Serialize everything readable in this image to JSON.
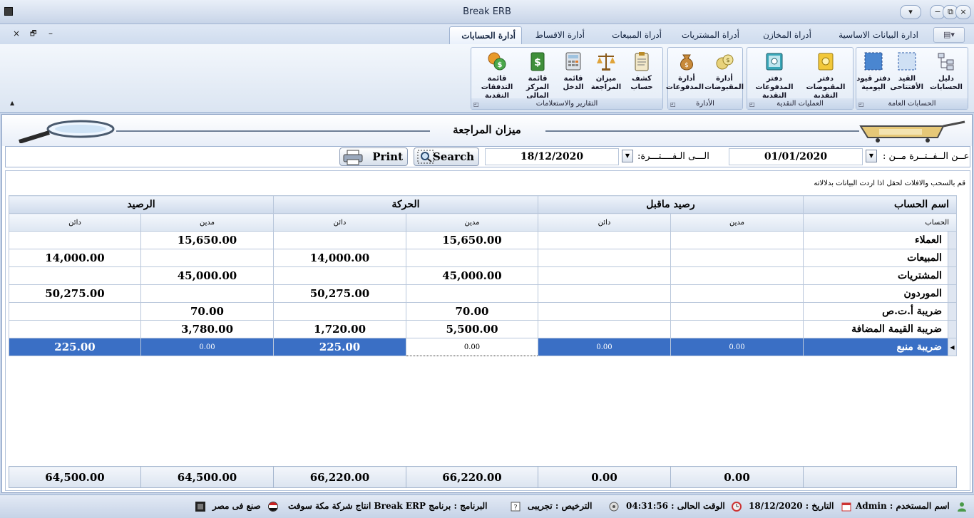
{
  "window": {
    "title": "Break ERB",
    "minimize": "−",
    "restore": "⧉",
    "close": "×",
    "extra": "▾"
  },
  "mdi": {
    "close": "×",
    "restore": "🗗",
    "minimize": "–"
  },
  "tabs": [
    "ادارة البيانات الاساسية",
    "أدراة المخازن",
    "أدراة المشتريات",
    "أدراة المبيعات",
    "أدارة الاقساط",
    "أدارة الحسابات"
  ],
  "ribbon": {
    "groups": {
      "general_accounts": "الحسابات العامة",
      "cash_ops": "العمليات النقدية",
      "management": "الأدارة",
      "reports": "التقارير والاستعلامات"
    },
    "buttons": {
      "chart_of_accounts": "دليل الحسابات",
      "opening_entry": "القيد الأفتتاحى",
      "journal": "دفتر قيود اليومية",
      "receipts_book": "دفتر المقبوضات النقدية",
      "payments_book": "دفتر المدفوعات النقدية",
      "manage_receipts": "أدارة المقبوضات",
      "manage_payments": "أدارة المدفوعات",
      "account_statement": "كشف حساب",
      "trial_balance": "ميزان المراجعة",
      "income_statement": "قائمة الدخل",
      "balance_sheet": "قائمة المركز المالى",
      "cash_flow": "قائمة التدفقات النقدية"
    }
  },
  "form": {
    "title": "ميزان المراجعة",
    "from_label": "عــن الــفــتــرة مــن :",
    "from_date": "01/01/2020",
    "to_label": "الـــى الـفــــتـــرة:",
    "to_date": "18/12/2020",
    "search_label": "Search",
    "print_label": "Print",
    "hint": "قم بالسحب والافلات لحقل اذا اردت البيانات بدلالاته"
  },
  "grid": {
    "bands": {
      "account_name": "اسم الحساب",
      "opening": "رصيد ماقبل",
      "movement": "الحركة",
      "balance": "الرصيد"
    },
    "sub": {
      "account": "الحساب",
      "debit": "مدين",
      "credit": "دائن"
    },
    "rows": [
      {
        "account": "العملاء",
        "open_debit": "",
        "open_credit": "",
        "mov_debit": "15,650.00",
        "mov_credit": "",
        "bal_debit": "15,650.00",
        "bal_credit": ""
      },
      {
        "account": "المبيعات",
        "open_debit": "",
        "open_credit": "",
        "mov_debit": "",
        "mov_credit": "14,000.00",
        "bal_debit": "",
        "bal_credit": "14,000.00"
      },
      {
        "account": "المشتريات",
        "open_debit": "",
        "open_credit": "",
        "mov_debit": "45,000.00",
        "mov_credit": "",
        "bal_debit": "45,000.00",
        "bal_credit": ""
      },
      {
        "account": "الموردون",
        "open_debit": "",
        "open_credit": "",
        "mov_debit": "",
        "mov_credit": "50,275.00",
        "bal_debit": "",
        "bal_credit": "50,275.00"
      },
      {
        "account": "ضريبة أ.ت.ص",
        "open_debit": "",
        "open_credit": "",
        "mov_debit": "70.00",
        "mov_credit": "",
        "bal_debit": "70.00",
        "bal_credit": ""
      },
      {
        "account": "ضريبة القيمة المضافة",
        "open_debit": "",
        "open_credit": "",
        "mov_debit": "5,500.00",
        "mov_credit": "1,720.00",
        "bal_debit": "3,780.00",
        "bal_credit": ""
      },
      {
        "account": "ضريبة منبع",
        "open_debit": "0.00",
        "open_credit": "0.00",
        "mov_debit": "0.00",
        "mov_credit": "225.00",
        "bal_debit": "0.00",
        "bal_credit": "225.00"
      }
    ],
    "totals": {
      "open_debit": "0.00",
      "open_credit": "0.00",
      "mov_debit": "66,220.00",
      "mov_credit": "66,220.00",
      "bal_debit": "64,500.00",
      "bal_credit": "64,500.00"
    }
  },
  "status": {
    "user": "اسم المستخدم : Admin",
    "date": "التاريخ : 18/12/2020",
    "time": "الوقت الحالى : 04:31:56",
    "license": "الترخيص : تجريبى",
    "program": "البرنامج : برنامج Break ERP  انتاج شركة مكة سوفت",
    "made_in": "صنع فى مصر"
  },
  "colors": {
    "selection": "#3a6fc5",
    "accent": "#9fb3d1"
  }
}
